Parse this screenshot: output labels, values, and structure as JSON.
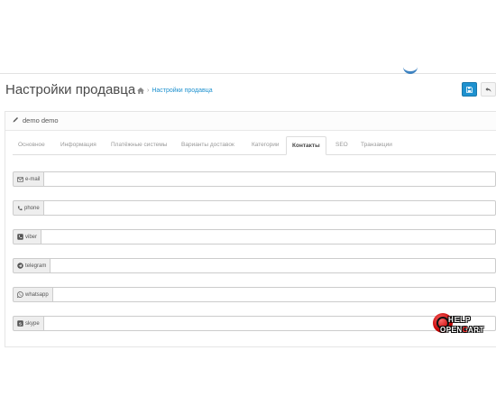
{
  "header": {
    "title": "Настройки продавца",
    "breadcrumb": {
      "separator": "›",
      "current": "Настройки продавца",
      "home_icon": "home-icon"
    },
    "save_icon": "save-icon",
    "back_icon": "reply-icon",
    "accent_color": "#1e91cf"
  },
  "panel": {
    "title": "demo demo",
    "title_icon": "pencil-icon"
  },
  "tabs": [
    {
      "label": "Основное",
      "active": false
    },
    {
      "label": "Информация",
      "active": false
    },
    {
      "label": "Платёжные системы",
      "active": false
    },
    {
      "label": "Варианты доставок",
      "active": false
    },
    {
      "label": "Категории",
      "active": false
    },
    {
      "label": "Контакты",
      "active": true
    },
    {
      "label": "SEO",
      "active": false
    },
    {
      "label": "Транзакции",
      "active": false
    }
  ],
  "fields": [
    {
      "label": "e-mail",
      "icon": "envelope-icon",
      "value": ""
    },
    {
      "label": "phone",
      "icon": "phone-icon",
      "value": ""
    },
    {
      "label": "viber",
      "icon": "viber-icon",
      "value": ""
    },
    {
      "label": "telegram",
      "icon": "telegram-icon",
      "value": ""
    },
    {
      "label": "whatsapp",
      "icon": "whatsapp-icon",
      "value": ""
    },
    {
      "label": "skype",
      "icon": "skype-icon",
      "value": ""
    }
  ],
  "watermark": {
    "line1": "HELP",
    "line2_a": "OPEN",
    "line2_b": "C",
    "line2_c": "ART"
  }
}
